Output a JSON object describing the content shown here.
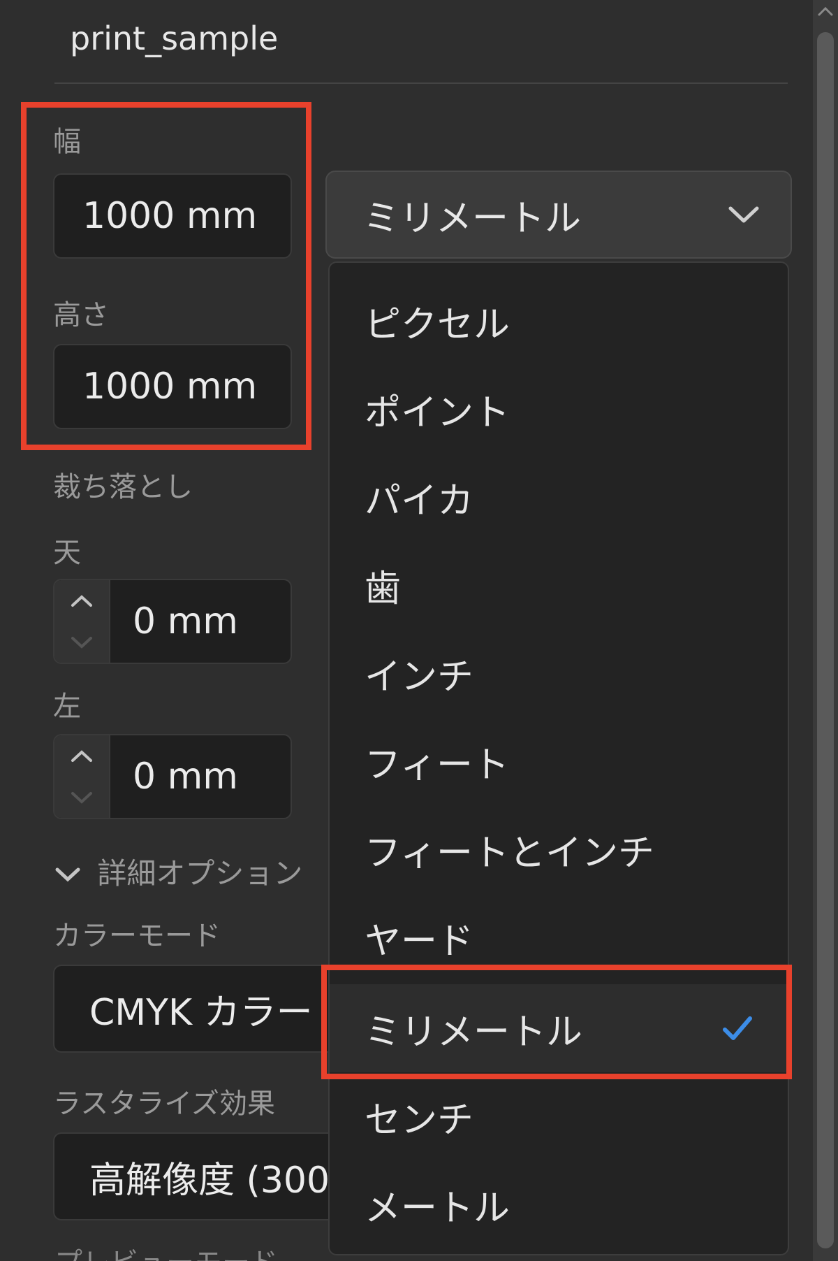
{
  "document": {
    "title": "print_sample"
  },
  "size": {
    "width_label": "幅",
    "width_value": "1000 mm",
    "height_label": "高さ",
    "height_value": "1000 mm"
  },
  "units": {
    "selected": "ミリメートル",
    "options": [
      "ピクセル",
      "ポイント",
      "パイカ",
      "歯",
      "インチ",
      "フィート",
      "フィートとインチ",
      "ヤード",
      "ミリメートル",
      "センチ",
      "メートル"
    ],
    "selected_index": 8,
    "check_mark": "✓"
  },
  "bleed": {
    "label": "裁ち落とし",
    "top_label": "天",
    "top_value": "0 mm",
    "left_label": "左",
    "left_value": "0 mm"
  },
  "advanced": {
    "label": "詳細オプション",
    "color_mode_label": "カラーモード",
    "color_mode_value": "CMYK カラー",
    "raster_label": "ラスタライズ効果",
    "raster_value": "高解像度 (300",
    "preview_label": "プレビューモード"
  },
  "icons": {
    "chevron_down": "chevron-down-icon",
    "step_up": "chevron-up-icon",
    "step_down": "chevron-down-icon",
    "check": "check-icon"
  },
  "colors": {
    "highlight": "#e8412c",
    "check": "#3c8de8"
  }
}
